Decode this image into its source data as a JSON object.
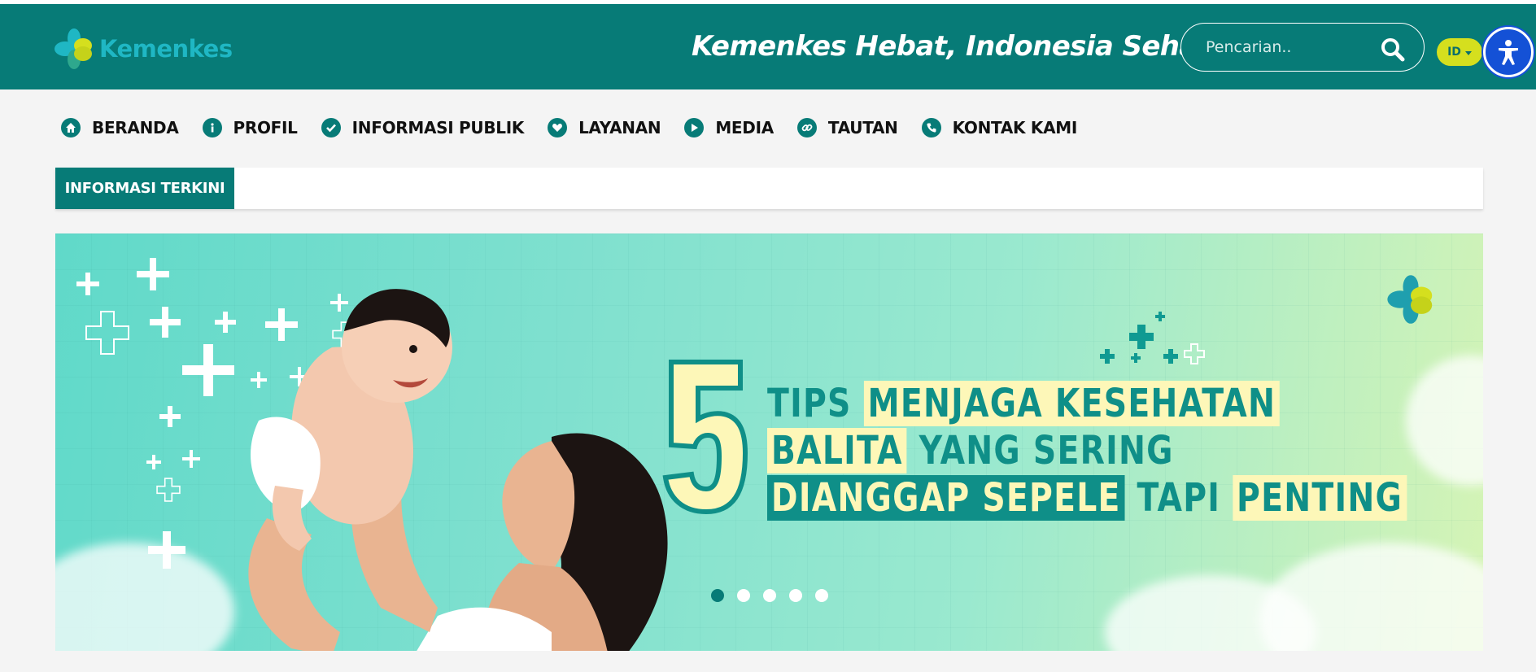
{
  "header": {
    "logo_text": "Kemenkes",
    "tagline": "Kemenkes Hebat, Indonesia Sehat",
    "search_placeholder": "Pencarian..",
    "language": "ID"
  },
  "nav": {
    "items": [
      {
        "label": "BERANDA",
        "icon": "home-icon"
      },
      {
        "label": "PROFIL",
        "icon": "info-icon"
      },
      {
        "label": "INFORMASI PUBLIK",
        "icon": "check-icon"
      },
      {
        "label": "LAYANAN",
        "icon": "heart-icon"
      },
      {
        "label": "MEDIA",
        "icon": "play-icon"
      },
      {
        "label": "TAUTAN",
        "icon": "link-icon"
      },
      {
        "label": "KONTAK KAMI",
        "icon": "phone-icon"
      }
    ]
  },
  "ticker": {
    "label": "INFORMASI TERKINI"
  },
  "banner": {
    "number": "5",
    "line1_a": "TIPS",
    "line1_b": "MENJAGA KESEHATAN",
    "line2_a": "BALITA",
    "line2_b": "YANG SERING",
    "line3_a": "DIANGGAP SEPELE",
    "line3_b": "TAPI",
    "line3_c": "PENTING",
    "slide_count": 5,
    "active_slide": 1
  },
  "colors": {
    "primary": "#077b77",
    "accent_yellow": "#d5df1e",
    "accessibility_blue": "#1451d6",
    "highlight": "#fdf7b8"
  }
}
